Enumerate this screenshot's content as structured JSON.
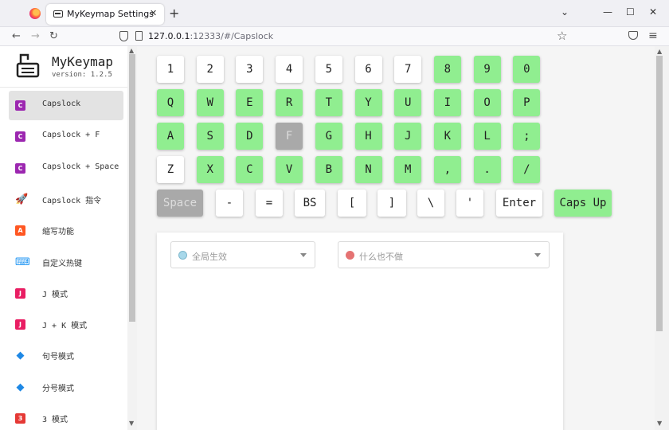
{
  "browser": {
    "tab_title": "MyKeymap Settings",
    "tab_close": "✕",
    "new_tab": "+",
    "controls": {
      "dropdown": "⌄",
      "minimize": "—",
      "maximize": "☐",
      "close": "✕"
    },
    "nav": {
      "back": "←",
      "forward": "→",
      "reload": "↻"
    },
    "url_host": "127.0.0.1",
    "url_rest": ":12333/#/Capslock",
    "bookmark_icon": "☆",
    "menu_icon": "≡"
  },
  "app": {
    "name": "MyKeymap",
    "version": "version: 1.2.5",
    "sidebar": [
      {
        "label": "Capslock",
        "icon": "C",
        "color": "#9c27b0",
        "active": true
      },
      {
        "label": "Capslock + F",
        "icon": "C",
        "color": "#9c27b0"
      },
      {
        "label": "Capslock + Space",
        "icon": "C",
        "color": "#9c27b0"
      },
      {
        "label": "Capslock 指令",
        "icon": "🚀",
        "color": "#ff5722"
      },
      {
        "label": "缩写功能",
        "icon": "A",
        "color": "#ff5722"
      },
      {
        "label": "自定义热键",
        "icon": "⌨",
        "color": "#2196f3"
      },
      {
        "label": "J 模式",
        "icon": "J",
        "color": "#e91e63"
      },
      {
        "label": "J + K 模式",
        "icon": "J",
        "color": "#e91e63"
      },
      {
        "label": "句号模式",
        "icon": "◆",
        "color": "#1e88e5"
      },
      {
        "label": "分号模式",
        "icon": "◆",
        "color": "#1e88e5"
      },
      {
        "label": "3 模式",
        "icon": "3",
        "color": "#e53935"
      }
    ],
    "keys": {
      "row1": [
        "1",
        "2",
        "3",
        "4",
        "5",
        "6",
        "7",
        "8",
        "9",
        "0"
      ],
      "row2": [
        "Q",
        "W",
        "E",
        "R",
        "T",
        "Y",
        "U",
        "I",
        "O",
        "P"
      ],
      "row3": [
        "A",
        "S",
        "D",
        "F",
        "G",
        "H",
        "J",
        "K",
        "L",
        ";"
      ],
      "row4": [
        "Z",
        "X",
        "C",
        "V",
        "B",
        "N",
        "M",
        ",",
        ".",
        "/"
      ],
      "row5": [
        "Space",
        "-",
        "=",
        "BS",
        "[",
        "]",
        "\\",
        "'",
        "Enter",
        "Caps Up"
      ]
    },
    "panel": {
      "scope_placeholder": "全局生效",
      "action_placeholder": "什么也不做"
    }
  }
}
